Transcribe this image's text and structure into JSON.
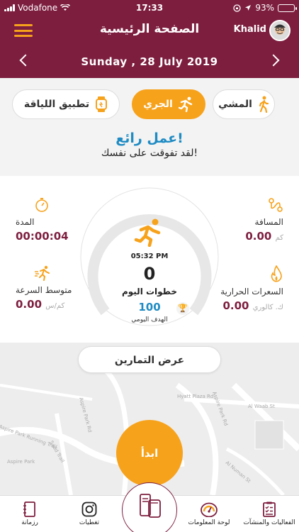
{
  "status": {
    "carrier": "Vodafone",
    "time": "17:33",
    "battery": "93%",
    "battery_level": 0.93
  },
  "header": {
    "title": "الصفحة الرئيسية",
    "user": "Khalid"
  },
  "date": {
    "label": "Sunday , 28 July 2019"
  },
  "tabs": [
    {
      "label": "تطبيق اللياقة",
      "icon": "watch-icon"
    },
    {
      "label": "الجري",
      "icon": "running-icon",
      "active": true
    },
    {
      "label": "المشي",
      "icon": "walking-icon"
    }
  ],
  "message": {
    "headline": "عمل رائع!",
    "subline": "لقد تفوقت على نفسك!"
  },
  "stats": {
    "duration": {
      "label": "المدة",
      "value": "00:00:04"
    },
    "distance": {
      "label": "المسافة",
      "value": "0.00",
      "unit": "كم"
    },
    "speed": {
      "label": "متوسط السرعة",
      "value": "0.00",
      "unit": "كم/س"
    },
    "calories": {
      "label": "السعرات الحرارية",
      "value": "0.00",
      "unit": "ك. كالوري"
    }
  },
  "center": {
    "time": "05:32 PM",
    "steps": "0",
    "steps_label": "خطوات اليوم",
    "goal": "100",
    "goal_label": "الهدف اليومي",
    "progress": 0
  },
  "map": {
    "show_workouts": "عرض التمارين",
    "start": "ابدأ",
    "labels": [
      "Hyatt Plaza Rd",
      "Aspire Park Rd",
      "Sadd Trail",
      "Al Waab St",
      "Al Numan St",
      "Aspire Park",
      "Aspire Park Running Trail"
    ]
  },
  "tabbar": [
    {
      "label": "رزمانة",
      "icon": "notebook-icon"
    },
    {
      "label": "تغطيات",
      "icon": "instagram-icon"
    },
    {
      "label": "",
      "icon": "ticket-phone-icon"
    },
    {
      "label": "لوحة المعلومات",
      "icon": "gauge-icon"
    },
    {
      "label": "الفعاليات والمنشآت",
      "icon": "checklist-icon"
    }
  ],
  "colors": {
    "maroon": "#7d1e3f",
    "orange": "#f7a21b",
    "blue": "#1e8bc3"
  }
}
